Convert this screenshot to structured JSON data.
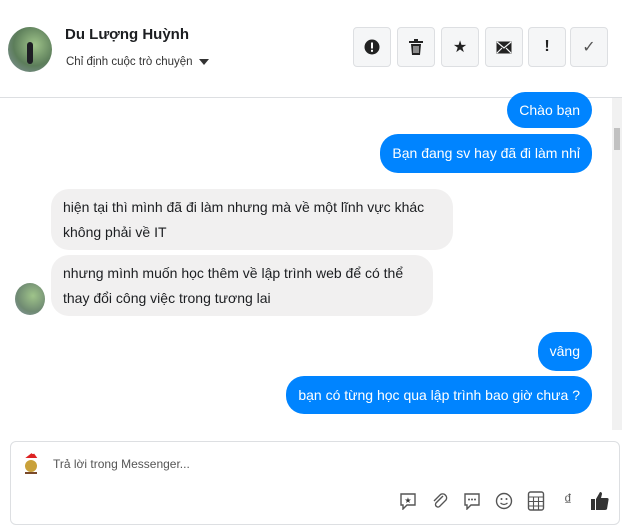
{
  "header": {
    "name": "Du Lượng Huỳnh",
    "assign_label": "Chỉ định cuộc trò chuyện",
    "buttons": [
      {
        "icon": "alert-circle-icon",
        "glyph": "!"
      },
      {
        "icon": "trash-icon",
        "glyph": "🗑"
      },
      {
        "icon": "star-icon",
        "glyph": "★"
      },
      {
        "icon": "mail-icon",
        "glyph": "✉"
      },
      {
        "icon": "exclamation-icon",
        "glyph": "!"
      },
      {
        "icon": "check-icon",
        "glyph": "✓"
      }
    ]
  },
  "messages": [
    {
      "from": "me",
      "text": "Chào bạn"
    },
    {
      "from": "me",
      "text": "Bạn đang sv hay đã đi làm nhỉ"
    },
    {
      "from": "them",
      "text": "hiện tại thì mình đã đi làm nhưng mà về một lĩnh vực khác không phải về IT"
    },
    {
      "from": "them",
      "text": "nhưng mình muốn học thêm về lập trình web để có thể thay đổi công việc trong tương lai"
    },
    {
      "from": "me",
      "text": "vâng"
    },
    {
      "from": "me",
      "text": "bạn có từng học qua lập trình bao giờ chưa ?"
    }
  ],
  "composer": {
    "placeholder": "Trả lời trong Messenger...",
    "currency_glyph": "₫",
    "tools": [
      "saved-reply-icon",
      "attach-icon",
      "chat-icon",
      "emoji-icon",
      "calculator-icon",
      "currency-icon",
      "like-icon"
    ]
  },
  "colors": {
    "accent": "#0084ff",
    "bubble_gray": "#f1f0f0"
  }
}
